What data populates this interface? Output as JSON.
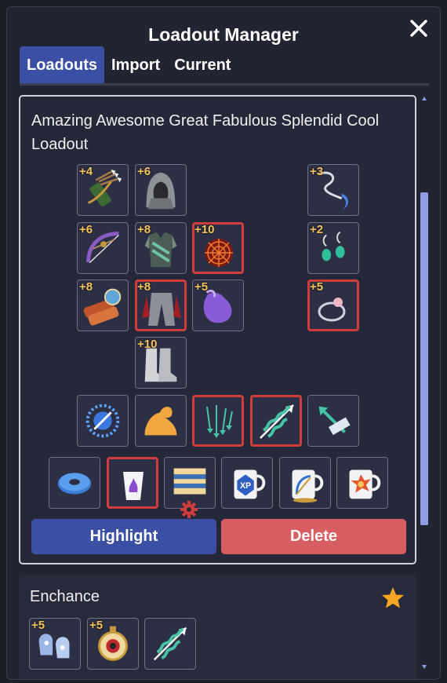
{
  "window": {
    "title": "Loadout Manager"
  },
  "tabs": [
    {
      "label": "Loadouts",
      "active": true
    },
    {
      "label": "Import",
      "active": false
    },
    {
      "label": "Current",
      "active": false
    }
  ],
  "loadout": {
    "name": "Amazing Awesome Great Fabulous Splendid Cool Loadout",
    "slots": [
      {
        "name": "quiver-icon",
        "badge": "+4",
        "highlighted": false
      },
      {
        "name": "hood-icon",
        "badge": "+6",
        "highlighted": false
      },
      {
        "name": "necklace-icon",
        "badge": "+3",
        "highlighted": false
      },
      {
        "name": "bow-icon",
        "badge": "+6",
        "highlighted": false
      },
      {
        "name": "armor-icon",
        "badge": "+8",
        "highlighted": false
      },
      {
        "name": "web-icon",
        "badge": "+10",
        "highlighted": true
      },
      {
        "name": "earrings-icon",
        "badge": "+2",
        "highlighted": false
      },
      {
        "name": "bracers-icon",
        "badge": "+8",
        "highlighted": false
      },
      {
        "name": "pants-icon",
        "badge": "+8",
        "highlighted": true
      },
      {
        "name": "pouch-icon",
        "badge": "+5",
        "highlighted": false
      },
      {
        "name": "ring-icon",
        "badge": "+5",
        "highlighted": true
      },
      {
        "name": "boots-icon",
        "badge": "+10",
        "highlighted": false
      },
      {
        "name": "burst-skill-icon",
        "badge": "",
        "highlighted": false
      },
      {
        "name": "strength-skill-icon",
        "badge": "",
        "highlighted": false
      },
      {
        "name": "arrow-rain-skill-icon",
        "badge": "",
        "highlighted": true
      },
      {
        "name": "piercing-arrow-skill-icon",
        "badge": "",
        "highlighted": true
      },
      {
        "name": "arrow-skill-icon",
        "badge": "",
        "highlighted": false
      },
      {
        "name": "donut-food-icon",
        "badge": "",
        "highlighted": false
      },
      {
        "name": "purple-potion-icon",
        "badge": "",
        "highlighted": true
      },
      {
        "name": "cake-food-icon",
        "badge": "",
        "highlighted": false
      },
      {
        "name": "xp-coffee-icon",
        "badge": "",
        "highlighted": false
      },
      {
        "name": "bow-coffee-icon",
        "badge": "",
        "highlighted": false
      },
      {
        "name": "fire-coffee-icon",
        "badge": "",
        "highlighted": false
      }
    ],
    "highlight_label": "Highlight",
    "delete_label": "Delete"
  },
  "loadout2": {
    "name": "Enchance",
    "slots": [
      {
        "name": "mittens-icon",
        "badge": "+5"
      },
      {
        "name": "eye-watch-icon",
        "badge": "+5"
      },
      {
        "name": "piercing-arrow-icon",
        "badge": ""
      }
    ]
  },
  "colors": {
    "accent": "#3b50a4",
    "danger": "#d75d63",
    "badge": "#f5c45c",
    "highlight": "#d13d3d"
  }
}
